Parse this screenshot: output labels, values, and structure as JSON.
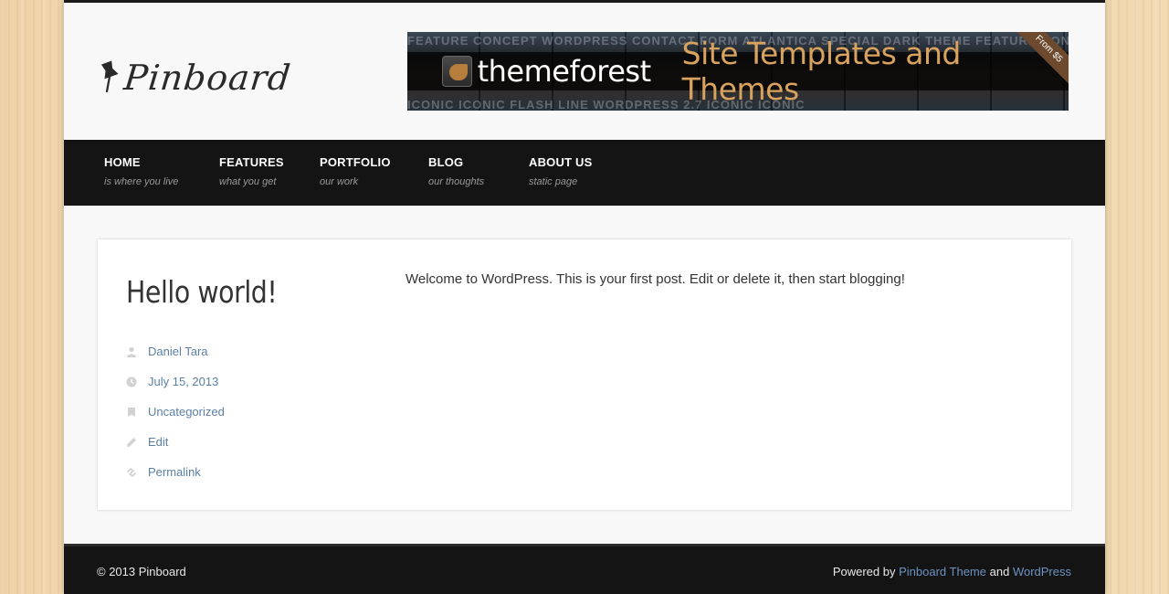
{
  "header": {
    "logo_text": "Pinboard",
    "banner": {
      "brand": "themeforest",
      "tagline": "Site Templates and Themes",
      "ribbon": "From $5",
      "tiles_top": "FEATURE  CONCEPT WORDPRESS  CONTACT FORM  ATLANTICA SPECIAL DARK  THEME  FEATURE  CONCEPT WORDPRESS  ATLANTICA",
      "tiles_bottom": "ICONIC  ICONIC  FLASH LINE  WORDPRESS 2.7  ICONIC  ICONIC"
    }
  },
  "nav": {
    "items": [
      {
        "label": "HOME",
        "sub": "is where you live"
      },
      {
        "label": "FEATURES",
        "sub": "what you get"
      },
      {
        "label": "PORTFOLIO",
        "sub": "our work"
      },
      {
        "label": "BLOG",
        "sub": "our thoughts"
      },
      {
        "label": "ABOUT US",
        "sub": "static page"
      }
    ]
  },
  "post": {
    "title": "Hello world!",
    "author": "Daniel Tara",
    "date": "July 15, 2013",
    "category": "Uncategorized",
    "edit": "Edit",
    "permalink": "Permalink",
    "body": "Welcome to WordPress. This is your first post. Edit or delete it, then start blogging!"
  },
  "footer": {
    "copyright": "© 2013 Pinboard",
    "powered_prefix": "Powered by",
    "theme_link": "Pinboard Theme",
    "and": "and",
    "wp_link": "WordPress"
  },
  "colors": {
    "link": "#5b7fa6",
    "nav_bg": "#141414",
    "banner_accent": "#d9a35f"
  }
}
